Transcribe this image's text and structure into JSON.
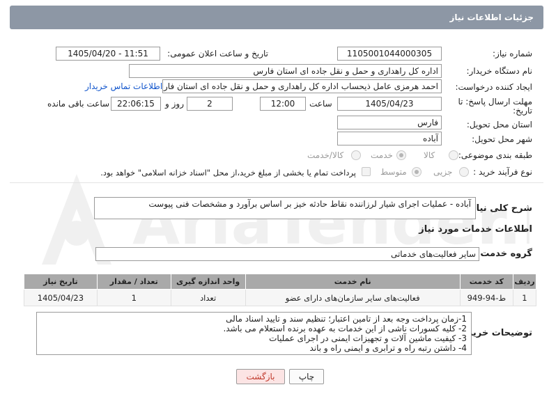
{
  "header": {
    "title": "جزئیات اطلاعات نیاز"
  },
  "watermark": {
    "text": "AriaTender.net"
  },
  "need_number": {
    "label": "شماره نیاز:",
    "value": "1105001044000305"
  },
  "announce": {
    "label": "تاریخ و ساعت اعلان عمومی:",
    "value": "1405/04/20 - 11:51"
  },
  "buyer": {
    "label": "نام دستگاه خریدار:",
    "value": "اداره کل راهداری و حمل و نقل جاده ای استان فارس"
  },
  "creator": {
    "label": "ایجاد کننده درخواست:",
    "value": "احمد هرمزی عامل ذیحساب اداره کل راهداری و حمل و نقل جاده ای استان فارس",
    "contact_link": "اطلاعات تماس خریدار"
  },
  "deadline": {
    "label_line1": "مهلت ارسال پاسخ: تا",
    "label_line2": "تاریخ:",
    "date": "1405/04/23",
    "time_label": "ساعت",
    "time": "12:00",
    "days": "2",
    "days_label": "روز و",
    "remaining": "22:06:15",
    "remaining_label": "ساعت باقی مانده"
  },
  "province": {
    "label": "استان محل تحویل:",
    "value": "فارس"
  },
  "city": {
    "label": "شهر محل تحویل:",
    "value": "آباده"
  },
  "category": {
    "label": "طبقه بندی موضوعی:",
    "options": [
      "کالا",
      "خدمت",
      "کالا/خدمت"
    ],
    "selected": "خدمت"
  },
  "purchase_type": {
    "label": "نوع فرآیند خرید :",
    "options": [
      "جزیی",
      "متوسط"
    ],
    "selected": "متوسط",
    "payment_note": "پرداخت تمام یا بخشی از مبلغ خرید،از محل \"اسناد خزانه اسلامی\" خواهد بود."
  },
  "summary": {
    "label": "شرح کلی نیاز:",
    "value": "آباده - عملیات اجرای شیار لرزاننده نقاط حادثه خیز بر اساس برآورد و مشخصات فنی پیوست"
  },
  "services_title": "اطلاعات خدمات مورد نیاز",
  "service_group": {
    "label": "گروه خدمت:",
    "value": "سایر فعالیت‌های خدماتی"
  },
  "table": {
    "headers": [
      "ردیف",
      "کد خدمت",
      "نام خدمت",
      "واحد اندازه گیری",
      "تعداد / مقدار",
      "تاریخ نیاز"
    ],
    "rows": [
      [
        "1",
        "ط-94-949",
        "فعالیت‌های سایر سازمان‌های دارای عضو",
        "تعداد",
        "1",
        "1405/04/23"
      ]
    ]
  },
  "buyer_notes": {
    "label": "توضیحات خریدار:",
    "lines": [
      "1-زمان پرداخت وجه بعد از تامین اعتبار؛ تنظیم سند و تایید اسناد مالی",
      "2- کلیه کسورات ناشی از این خدمات به عهده برنده استعلام می باشد.",
      "3- کیفیت ماشین آلات و تجهیزات ایمنی در اجرای عملیات",
      "4- داشتن رتبه راه و ترابری و ایمنی راه و باند"
    ]
  },
  "buttons": {
    "print": "چاپ",
    "back": "بازگشت"
  },
  "colors": {
    "header": "#8d97a5",
    "link": "#1155cc",
    "back_text": "#c0392b",
    "back_bg": "#fce4e4"
  }
}
